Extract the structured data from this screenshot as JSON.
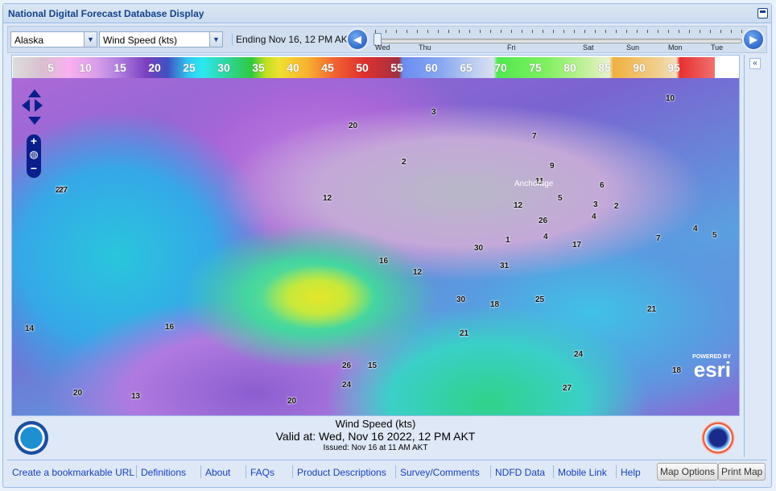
{
  "window": {
    "title": "National Digital Forecast Database Display"
  },
  "toolbar": {
    "region": "Alaska",
    "element": "Wind Speed (kts)",
    "ending": "Ending Nov 16, 12 PM AKT",
    "timeline_days": [
      "Wed",
      "Thu",
      "Fri",
      "Sat",
      "Sun",
      "Mon",
      "Tue"
    ],
    "timeline_position": 0
  },
  "legend": {
    "labels": [
      "5",
      "10",
      "15",
      "20",
      "25",
      "30",
      "35",
      "40",
      "45",
      "50",
      "55",
      "60",
      "65",
      "70",
      "75",
      "80",
      "85",
      "90",
      "95"
    ]
  },
  "map": {
    "station_values": [
      "10",
      "3",
      "7",
      "20",
      "2",
      "9",
      "11",
      "6",
      "5",
      "3",
      "2",
      "Anchorage",
      "4",
      "12",
      "12",
      "27",
      "26",
      "4",
      "17",
      "7",
      "4",
      "5",
      "1",
      "30",
      "31",
      "16",
      "12",
      "30",
      "18",
      "25",
      "21",
      "14",
      "16",
      "21",
      "27",
      "24",
      "26",
      "15",
      "24",
      "27",
      "18",
      "20",
      "13",
      "20"
    ],
    "attribution": {
      "powered": "POWERED BY",
      "brand": "esri"
    }
  },
  "caption": {
    "element": "Wind Speed (kts)",
    "valid": "Valid at: Wed, Nov 16 2022, 12 PM AKT",
    "issued": "Issued: Nov 16 at 11 AM AKT"
  },
  "footer": {
    "links": [
      "Create a bookmarkable URL",
      "Definitions",
      "About",
      "FAQs",
      "Product Descriptions",
      "Survey/Comments",
      "NDFD Data",
      "Mobile Link",
      "Help"
    ],
    "map_options": "Map Options",
    "print_map": "Print Map"
  }
}
